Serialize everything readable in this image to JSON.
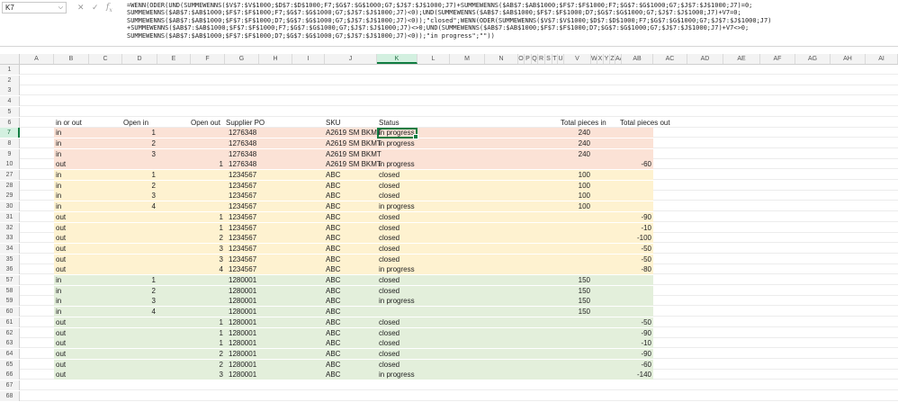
{
  "name_box": "K7",
  "formula_icons": [
    "cancel-icon",
    "enter-icon",
    "fx-icon"
  ],
  "formula": "=WENN(ODER(UND(SUMMEWENNS($V$7:$V$1000;$D$7:$D$1000;F7;$G$7:$G$1000;G7;$J$7:$J$1000;J7)+SUMMEWENNS($AB$7:$AB$1000;$F$7:$F$1000;F7;$G$7:$G$1000;G7;$J$7:$J$1000;J7)=0;\nSUMMEWENNS($AB$7:$AB$1000;$F$7:$F$1000;F7;$G$7:$G$1000;G7;$J$7:$J$1000;J7)<0);UND(SUMMEWENNS($AB$7:$AB$1000;$F$7:$F$1000;D7;$G$7:$G$1000;G7;$J$7:$J$1000;J7)+V7=0;\nSUMMEWENNS($AB$7:$AB$1000;$F$7:$F$1000;D7;$G$7:$G$1000;G7;$J$7:$J$1000;J7)<0));\"closed\";WENN(ODER(SUMMEWENNS($V$7:$V$1000;$D$7:$D$1000;F7;$G$7:$G$1000;G7;$J$7:$J$1000;J7)\n+SUMMEWENNS($AB$7:$AB$1000;$F$7:$F$1000;F7;$G$7:$G$1000;G7;$J$7:$J$1000;J7)<>0;UND(SUMMEWENNS($AB$7:$AB$1000;$F$7:$F$1000;D7;$G$7:$G$1000;G7;$J$7:$J$1000;J7)+V7<>0;\nSUMMEWENNS($AB$7:$AB$1000;$F$7:$F$1000;D7;$G$7:$G$1000;G7;$J$7:$J$1000;J7)<0));\"in progress\";\"\"))",
  "selected_column": "K",
  "selected_row": "7",
  "columns": [
    "A",
    "B",
    "C",
    "D",
    "E",
    "F",
    "G",
    "H",
    "I",
    "J",
    "K",
    "L",
    "M",
    "N",
    "O",
    "P",
    "Q",
    "R",
    "S",
    "T",
    "U",
    "V",
    "W",
    "X",
    "Y",
    "Z",
    "AA",
    "AB",
    "AC",
    "AD",
    "AE",
    "AF",
    "AG",
    "AH",
    "AI"
  ],
  "headers": {
    "in_out": "in or out",
    "open_in": "Open in",
    "open_out": "Open out",
    "supplier_po": "Supplier PO",
    "sku": "SKU",
    "status": "Status",
    "total_in": "Total pieces in",
    "total_out": "Total pieces out"
  },
  "empty_rows_top": [
    "1",
    "2",
    "3",
    "4",
    "5"
  ],
  "header_row": "6",
  "rows": [
    {
      "row": "7",
      "color": "red",
      "type": "in",
      "open_in": "1",
      "open_out": "",
      "po": "1276348",
      "sku": "A2619 SM BKMT",
      "status": "in progress",
      "total_in": "240",
      "total_out": ""
    },
    {
      "row": "8",
      "color": "red",
      "type": "in",
      "open_in": "2",
      "open_out": "",
      "po": "1276348",
      "sku": "A2619 SM BKMT",
      "status": "in progress",
      "total_in": "240",
      "total_out": ""
    },
    {
      "row": "9",
      "color": "red",
      "type": "in",
      "open_in": "3",
      "open_out": "",
      "po": "1276348",
      "sku": "A2619 SM BKMT",
      "status": "",
      "total_in": "240",
      "total_out": ""
    },
    {
      "row": "10",
      "color": "red",
      "type": "out",
      "open_in": "",
      "open_out": "1",
      "po": "1276348",
      "sku": "A2619 SM BKMT",
      "status": "in progress",
      "total_in": "",
      "total_out": "-60"
    },
    {
      "row": "27",
      "color": "yel",
      "type": "in",
      "open_in": "1",
      "open_out": "",
      "po": "1234567",
      "sku": "ABC",
      "status": "closed",
      "total_in": "100",
      "total_out": ""
    },
    {
      "row": "28",
      "color": "yel",
      "type": "in",
      "open_in": "2",
      "open_out": "",
      "po": "1234567",
      "sku": "ABC",
      "status": "closed",
      "total_in": "100",
      "total_out": ""
    },
    {
      "row": "29",
      "color": "yel",
      "type": "in",
      "open_in": "3",
      "open_out": "",
      "po": "1234567",
      "sku": "ABC",
      "status": "closed",
      "total_in": "100",
      "total_out": ""
    },
    {
      "row": "30",
      "color": "yel",
      "type": "in",
      "open_in": "4",
      "open_out": "",
      "po": "1234567",
      "sku": "ABC",
      "status": "in progress",
      "total_in": "100",
      "total_out": ""
    },
    {
      "row": "31",
      "color": "yel",
      "type": "out",
      "open_in": "",
      "open_out": "1",
      "po": "1234567",
      "sku": "ABC",
      "status": "closed",
      "total_in": "",
      "total_out": "-90"
    },
    {
      "row": "32",
      "color": "yel",
      "type": "out",
      "open_in": "",
      "open_out": "1",
      "po": "1234567",
      "sku": "ABC",
      "status": "closed",
      "total_in": "",
      "total_out": "-10"
    },
    {
      "row": "33",
      "color": "yel",
      "type": "out",
      "open_in": "",
      "open_out": "2",
      "po": "1234567",
      "sku": "ABC",
      "status": "closed",
      "total_in": "",
      "total_out": "-100"
    },
    {
      "row": "34",
      "color": "yel",
      "type": "out",
      "open_in": "",
      "open_out": "3",
      "po": "1234567",
      "sku": "ABC",
      "status": "closed",
      "total_in": "",
      "total_out": "-50"
    },
    {
      "row": "35",
      "color": "yel",
      "type": "out",
      "open_in": "",
      "open_out": "3",
      "po": "1234567",
      "sku": "ABC",
      "status": "closed",
      "total_in": "",
      "total_out": "-50"
    },
    {
      "row": "36",
      "color": "yel",
      "type": "out",
      "open_in": "",
      "open_out": "4",
      "po": "1234567",
      "sku": "ABC",
      "status": "in progress",
      "total_in": "",
      "total_out": "-80"
    },
    {
      "row": "57",
      "color": "grn",
      "type": "in",
      "open_in": "1",
      "open_out": "",
      "po": "1280001",
      "sku": "ABC",
      "status": "closed",
      "total_in": "150",
      "total_out": ""
    },
    {
      "row": "58",
      "color": "grn",
      "type": "in",
      "open_in": "2",
      "open_out": "",
      "po": "1280001",
      "sku": "ABC",
      "status": "closed",
      "total_in": "150",
      "total_out": ""
    },
    {
      "row": "59",
      "color": "grn",
      "type": "in",
      "open_in": "3",
      "open_out": "",
      "po": "1280001",
      "sku": "ABC",
      "status": "in progress",
      "total_in": "150",
      "total_out": ""
    },
    {
      "row": "60",
      "color": "grn",
      "type": "in",
      "open_in": "4",
      "open_out": "",
      "po": "1280001",
      "sku": "ABC",
      "status": "",
      "total_in": "150",
      "total_out": ""
    },
    {
      "row": "61",
      "color": "grn",
      "type": "out",
      "open_in": "",
      "open_out": "1",
      "po": "1280001",
      "sku": "ABC",
      "status": "closed",
      "total_in": "",
      "total_out": "-50"
    },
    {
      "row": "62",
      "color": "grn",
      "type": "out",
      "open_in": "",
      "open_out": "1",
      "po": "1280001",
      "sku": "ABC",
      "status": "closed",
      "total_in": "",
      "total_out": "-90"
    },
    {
      "row": "63",
      "color": "grn",
      "type": "out",
      "open_in": "",
      "open_out": "1",
      "po": "1280001",
      "sku": "ABC",
      "status": "closed",
      "total_in": "",
      "total_out": "-10"
    },
    {
      "row": "64",
      "color": "grn",
      "type": "out",
      "open_in": "",
      "open_out": "2",
      "po": "1280001",
      "sku": "ABC",
      "status": "closed",
      "total_in": "",
      "total_out": "-90"
    },
    {
      "row": "65",
      "color": "grn",
      "type": "out",
      "open_in": "",
      "open_out": "2",
      "po": "1280001",
      "sku": "ABC",
      "status": "closed",
      "total_in": "",
      "total_out": "-60"
    },
    {
      "row": "66",
      "color": "grn",
      "type": "out",
      "open_in": "",
      "open_out": "3",
      "po": "1280001",
      "sku": "ABC",
      "status": "in progress",
      "total_in": "",
      "total_out": "-140"
    }
  ],
  "empty_rows_bottom": [
    "67",
    "68"
  ],
  "colors": {
    "red_band": "#fbe2d6",
    "yellow_band": "#fef2d0",
    "green_band": "#e3efdb",
    "selection": "#107c41"
  }
}
